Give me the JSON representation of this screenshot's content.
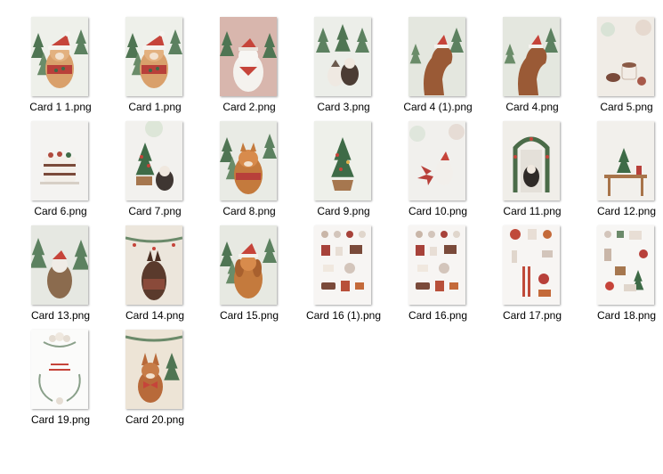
{
  "window": {
    "view": "large-icons"
  },
  "files": [
    {
      "name": "Card 1 1.png",
      "thumb_icon": "dog-santa-hat-icon",
      "bg": "#eef0ea",
      "accent": "#c6443a",
      "scene": "dog-hat"
    },
    {
      "name": "Card 1.png",
      "thumb_icon": "dog-santa-hat-icon",
      "bg": "#eef0ea",
      "accent": "#c6443a",
      "scene": "dog-hat"
    },
    {
      "name": "Card 2.png",
      "thumb_icon": "white-dog-icon",
      "bg": "#d8b6ad",
      "accent": "#c6443a",
      "scene": "white-dog"
    },
    {
      "name": "Card 3.png",
      "thumb_icon": "dogs-trees-icon",
      "bg": "#eceee9",
      "accent": "#6b5a4e",
      "scene": "dogs-trees"
    },
    {
      "name": "Card 4 (1).png",
      "thumb_icon": "horse-icon",
      "bg": "#e4e7df",
      "accent": "#9a5a36",
      "scene": "horse"
    },
    {
      "name": "Card 4.png",
      "thumb_icon": "horse-icon",
      "bg": "#e4e7df",
      "accent": "#9a5a36",
      "scene": "horse"
    },
    {
      "name": "Card 5.png",
      "thumb_icon": "cocoa-icon",
      "bg": "#f0ece6",
      "accent": "#a7594a",
      "scene": "cocoa"
    },
    {
      "name": "Card 6.png",
      "thumb_icon": "cake-icon",
      "bg": "#f4f3f1",
      "accent": "#b04a3d",
      "scene": "cake"
    },
    {
      "name": "Card 7.png",
      "thumb_icon": "tree-dog-icon",
      "bg": "#f2f1ee",
      "accent": "#3e6b47",
      "scene": "tree-dog"
    },
    {
      "name": "Card 8.png",
      "thumb_icon": "fox-dog-icon",
      "bg": "#e9ebe5",
      "accent": "#c47a3d",
      "scene": "fox-dog"
    },
    {
      "name": "Card 9.png",
      "thumb_icon": "tree-basket-icon",
      "bg": "#eef0ea",
      "accent": "#3e6b47",
      "scene": "tree-basket"
    },
    {
      "name": "Card 10.png",
      "thumb_icon": "poinsettia-icon",
      "bg": "#f1f0ed",
      "accent": "#b8403a",
      "scene": "poinsettia"
    },
    {
      "name": "Card 11.png",
      "thumb_icon": "wreath-door-icon",
      "bg": "#f0eee9",
      "accent": "#4a6b48",
      "scene": "wreath-dog"
    },
    {
      "name": "Card 12.png",
      "thumb_icon": "table-tree-icon",
      "bg": "#f2f0ec",
      "accent": "#a8744a",
      "scene": "table-tree"
    },
    {
      "name": "Card 13.png",
      "thumb_icon": "husky-icon",
      "bg": "#e6e8e2",
      "accent": "#8b6b4e",
      "scene": "husky"
    },
    {
      "name": "Card 14.png",
      "thumb_icon": "doberman-icon",
      "bg": "#ece6dc",
      "accent": "#5a3a2c",
      "scene": "doberman"
    },
    {
      "name": "Card 15.png",
      "thumb_icon": "spaniel-icon",
      "bg": "#e7e9e2",
      "accent": "#c6443a",
      "scene": "spaniel"
    },
    {
      "name": "Card 16 (1).png",
      "thumb_icon": "clipart-sheet-icon",
      "bg": "#f7f5f3",
      "accent": "#a7423a",
      "scene": "clipart"
    },
    {
      "name": "Card 16.png",
      "thumb_icon": "clipart-sheet-icon",
      "bg": "#f7f5f3",
      "accent": "#a7423a",
      "scene": "clipart"
    },
    {
      "name": "Card 17.png",
      "thumb_icon": "winter-clipart-icon",
      "bg": "#f7f5f3",
      "accent": "#c04a3a",
      "scene": "clipart2"
    },
    {
      "name": "Card 18.png",
      "thumb_icon": "christmas-clipart-icon",
      "bg": "#f7f6f4",
      "accent": "#6b8a6a",
      "scene": "clipart3"
    },
    {
      "name": "Card 19.png",
      "thumb_icon": "floral-frame-icon",
      "bg": "#fbfbfa",
      "accent": "#8aa08a",
      "scene": "frame"
    },
    {
      "name": "Card 20.png",
      "thumb_icon": "corgi-icon",
      "bg": "#ede4d6",
      "accent": "#b86a3a",
      "scene": "corgi"
    }
  ]
}
